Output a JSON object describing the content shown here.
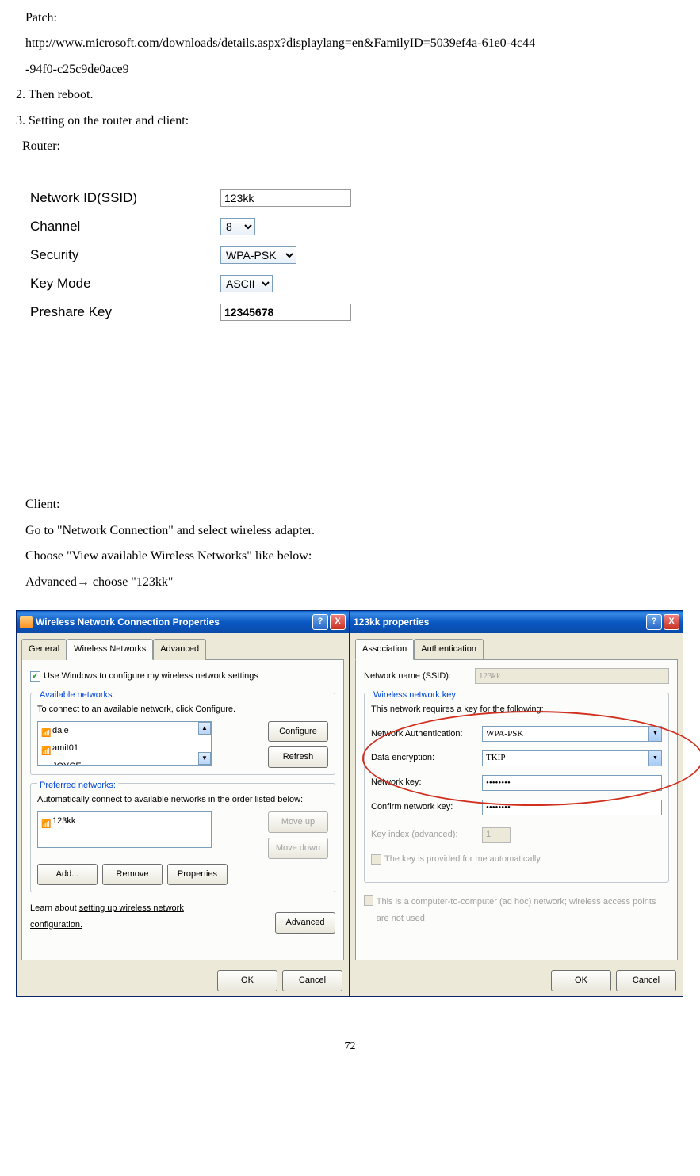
{
  "doc": {
    "patch_label": "Patch:",
    "patch_url_line1": "http://www.microsoft.com/downloads/details.aspx?displaylang=en&FamilyID=5039ef4a-61e0-4c44",
    "patch_url_line2": "-94f0-c25c9de0ace9",
    "step2": "2. Then reboot.",
    "step3": "3. Setting on the router and client:",
    "router_label": "Router:",
    "client_label": "Client:",
    "client_line1": "Go to \"Network Connection\" and select wireless adapter.",
    "client_line2": "Choose \"View available Wireless Networks\" like below:",
    "client_line3": "Advanced→ choose \"123kk\"",
    "page_number": "72"
  },
  "router": {
    "rows": {
      "ssid_label": "Network ID(SSID)",
      "ssid_value": "123kk",
      "channel_label": "Channel",
      "channel_value": "8",
      "security_label": "Security",
      "security_value": "WPA-PSK",
      "keymode_label": "Key Mode",
      "keymode_value": "ASCII",
      "preshare_label": "Preshare Key",
      "preshare_value": "12345678"
    }
  },
  "dlg1": {
    "title": "Wireless Network Connection Properties",
    "help": "?",
    "close": "X",
    "tabs": {
      "general": "General",
      "wireless": "Wireless Networks",
      "advanced": "Advanced"
    },
    "use_windows": "Use Windows to configure my wireless network settings",
    "available": {
      "title": "Available networks:",
      "desc": "To connect to an available network, click Configure.",
      "items": [
        "dale",
        "amit01",
        "JOYCE"
      ],
      "configure": "Configure",
      "refresh": "Refresh"
    },
    "preferred": {
      "title": "Preferred networks:",
      "desc": "Automatically connect to available networks in the order listed below:",
      "items": [
        "123kk"
      ],
      "moveup": "Move up",
      "movedown": "Move down",
      "add": "Add...",
      "remove": "Remove",
      "properties": "Properties"
    },
    "learn_label": "Learn about ",
    "learn_link": "setting up wireless network configuration.",
    "adv_btn": "Advanced",
    "ok": "OK",
    "cancel": "Cancel"
  },
  "dlg2": {
    "title": "123kk properties",
    "help": "?",
    "close": "X",
    "tabs": {
      "assoc": "Association",
      "auth": "Authentication"
    },
    "ssid_label": "Network name (SSID):",
    "ssid_value": "123kk",
    "group_title": "Wireless network key",
    "group_desc": "This network requires a key for the following:",
    "auth_label": "Network Authentication:",
    "auth_value": "WPA-PSK",
    "enc_label": "Data encryption:",
    "enc_value": "TKIP",
    "key_label": "Network key:",
    "key_value": "••••••••",
    "confirm_label": "Confirm network key:",
    "confirm_value": "••••••••",
    "keyindex_label": "Key index (advanced):",
    "keyindex_value": "1",
    "auto_label": "The key is provided for me automatically",
    "adhoc_label": "This is a computer-to-computer (ad hoc) network; wireless access points are not used",
    "ok": "OK",
    "cancel": "Cancel"
  }
}
